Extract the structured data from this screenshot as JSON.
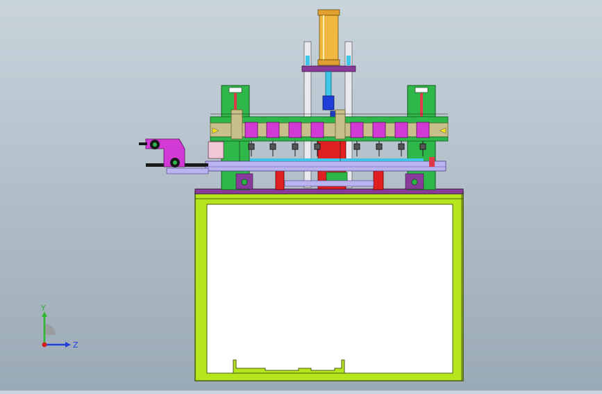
{
  "viewport": {
    "background_top": "#c9d4dc",
    "background_bottom": "#9aaab6"
  },
  "model": {
    "colors": {
      "frame": "#b5e61d",
      "frame_edge": "#4a5a10",
      "top_plate": "#8a3a9a",
      "cylinder": "#f0b840",
      "rod": "#3fc6e8",
      "column": "#e8e8ee",
      "green_block": "#2fb84a",
      "magenta": "#d23ad6",
      "red": "#e02020",
      "lavender": "#b9b3ef",
      "khaki": "#c8c08a",
      "dark": "#1a1a1a"
    }
  },
  "triad": {
    "y_label": "Y",
    "z_label": "Z",
    "y_color": "#2db82d",
    "z_color": "#1f3fd8",
    "origin_color": "#d81f1f"
  }
}
